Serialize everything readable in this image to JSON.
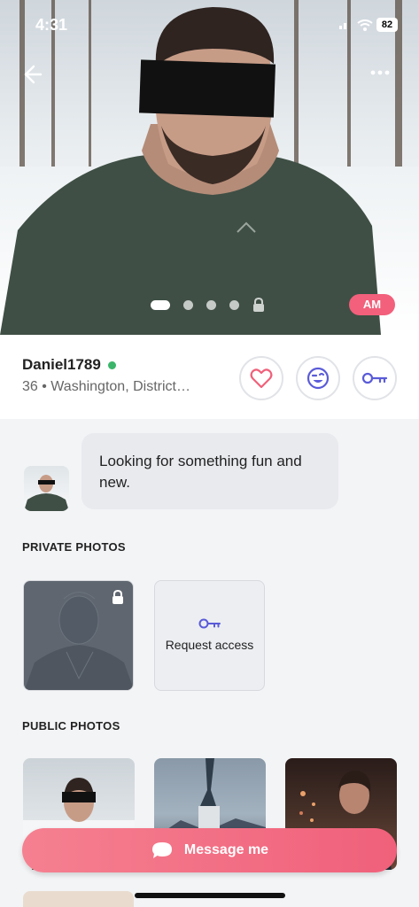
{
  "status_bar": {
    "time": "4:31",
    "battery": "82"
  },
  "hero": {
    "badge": "AM",
    "pager_count": 4
  },
  "profile": {
    "username": "Daniel1789",
    "details": "36 • Washington, District…"
  },
  "about": {
    "text": "Looking for something fun and new."
  },
  "private_photos": {
    "title": "PRIVATE PHOTOS",
    "request_text": "Request access"
  },
  "public_photos": {
    "title": "PUBLIC PHOTOS"
  },
  "cta": {
    "label": "Message me"
  },
  "colors": {
    "accent": "#f2607b",
    "online": "#3bb56a",
    "purple": "#5a5bd8"
  },
  "icons": {
    "back": "back-arrow-icon",
    "more": "more-dots-icon",
    "like": "heart-icon",
    "wink": "wink-face-icon",
    "key": "key-icon",
    "lock": "lock-icon",
    "chat": "chat-bubble-icon"
  }
}
